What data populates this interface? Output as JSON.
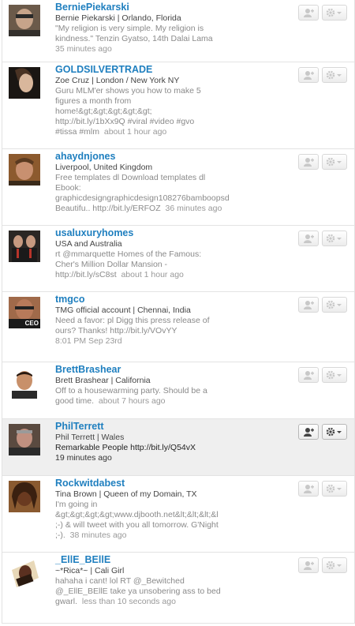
{
  "users": [
    {
      "username": "BerniePiekarski",
      "meta": "Bernie Piekarski | Orlando, Florida",
      "bio_lines": [
        "\"My religion is very simple. My religion is",
        "kindness.\" Tenzin Gyatso, 14th Dalai Lama"
      ],
      "time": "35 minutes ago",
      "icons": [
        "follow-icon",
        "gear-icon"
      ]
    },
    {
      "username": "GOLDSILVERTRADE",
      "meta": "Zoe Cruz | London / New York NY",
      "bio_lines": [
        "Guru MLM'er shows you how to make 5",
        "figures a month from",
        "home!&gt;&gt;&gt;&gt;&gt;",
        "http://bit.ly/1bXx9Q #viral #video #gvo",
        "#tissa #mlm"
      ],
      "time": "about 1 hour ago"
    },
    {
      "username": "ahaydnjones",
      "meta": "Liverpool, United Kingdom",
      "bio_lines": [
        "Free templates dl Download templates dl",
        "Ebook:",
        "graphicdesigngraphicdesign108276bamboopsd",
        "Beautifu.. http://bit.ly/ERFOZ"
      ],
      "time": "36 minutes ago"
    },
    {
      "username": "usaluxuryhomes",
      "meta": "USA and Australia",
      "bio_lines": [
        "rt @mmarquette Homes of the Famous:",
        "Cher's Million Dollar Mansion -",
        "http://bit.ly/sC8st"
      ],
      "time": "about 1 hour ago"
    },
    {
      "username": "tmgco",
      "meta": "TMG official account | Chennai, India",
      "bio_lines": [
        "Need a favor: pl Digg this press release of",
        "ours? Thanks! http://bit.ly/VOvYY"
      ],
      "time": "8:01 PM Sep 23rd",
      "avatar_label": "CEO"
    },
    {
      "username": "BrettBrashear",
      "meta": "Brett Brashear | California",
      "bio_lines": [
        "Off to a housewarming party. Should be a",
        "good time."
      ],
      "time": "about 7 hours ago"
    },
    {
      "username": "PhilTerrett",
      "meta": "Phil Terrett | Wales",
      "bio_lines": [
        "Remarkable People http://bit.ly/Q54vX"
      ],
      "time": "19 minutes ago",
      "highlighted": true
    },
    {
      "username": "Rockwitdabest",
      "meta": "Tina Brown | Queen of my Domain, TX",
      "bio_lines": [
        "I'm going in",
        "&gt;&gt;&gt;&gt;www.djbooth.net&lt;&lt;&lt;&l",
        ";-) & will tweet with you all tomorrow. G'Night",
        ";-)."
      ],
      "time": "38 minutes ago"
    },
    {
      "username": "_EllE_BEllE",
      "meta": "~*Rica*~ | Cali Girl",
      "bio_lines": [
        "hahaha i cant! lol RT @_Bewitched",
        "@_EllE_BEllE take ya unsobering ass to bed",
        "gwarl."
      ],
      "time": "less than 10 seconds ago"
    }
  ],
  "colors": {
    "link": "#1f7fbf",
    "muted": "#8a8a8a",
    "highlight_bg": "#efefef"
  }
}
